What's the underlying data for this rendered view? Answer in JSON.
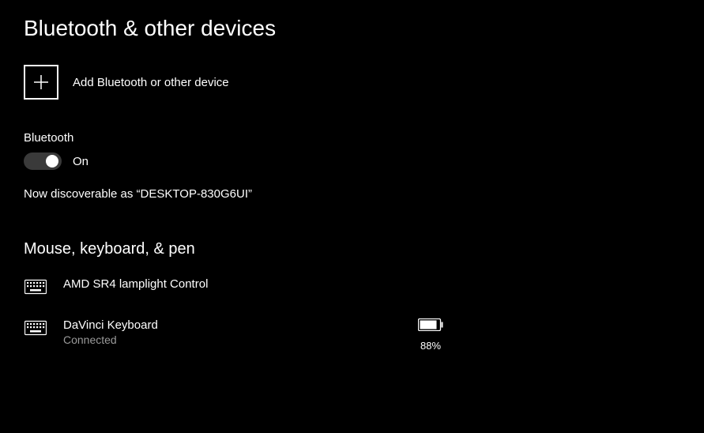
{
  "title": "Bluetooth & other devices",
  "addDevice": {
    "label": "Add Bluetooth or other device"
  },
  "bluetooth": {
    "label": "Bluetooth",
    "state": "On",
    "discoverable": "Now discoverable as “DESKTOP-830G6UI”"
  },
  "sections": {
    "input": {
      "heading": "Mouse, keyboard, & pen",
      "devices": [
        {
          "name": "AMD SR4 lamplight Control",
          "status": "",
          "battery": ""
        },
        {
          "name": "DaVinci Keyboard",
          "status": "Connected",
          "battery": "88%"
        }
      ]
    }
  }
}
